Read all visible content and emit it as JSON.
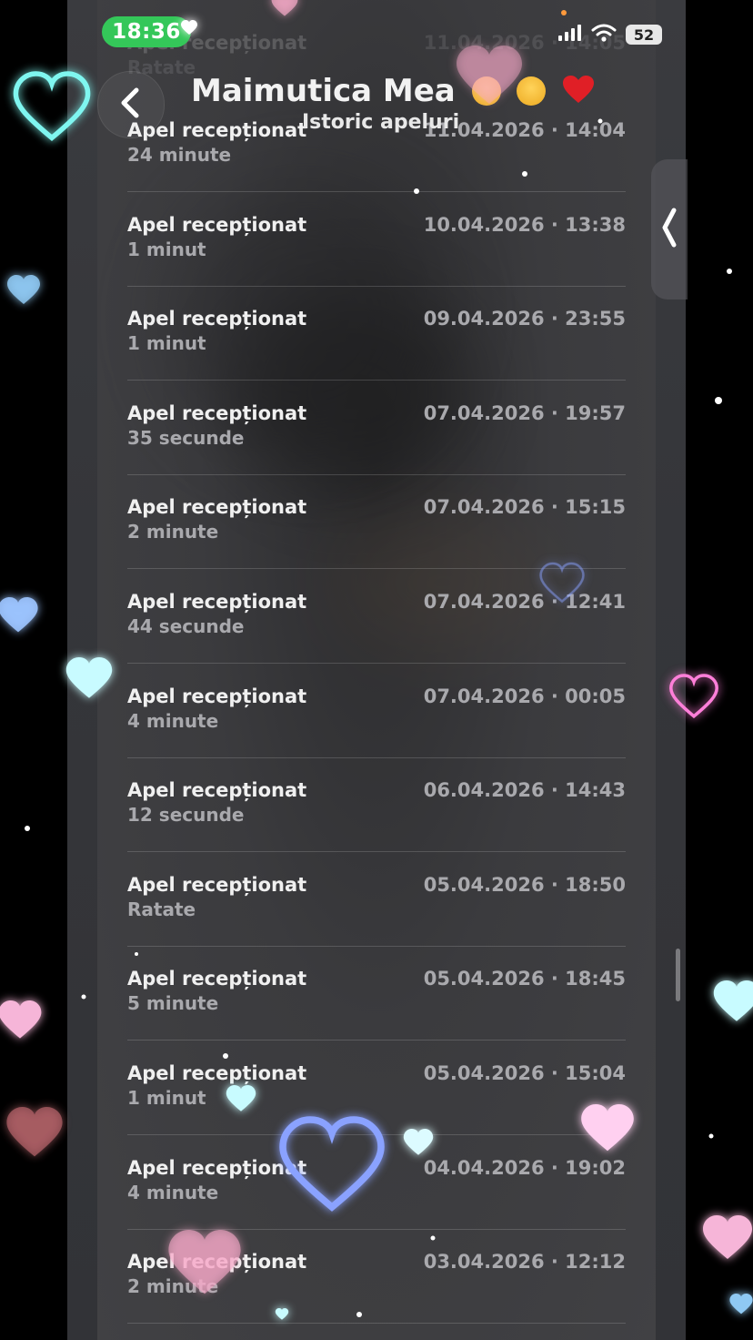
{
  "status_bar": {
    "time": "18:36",
    "battery": "52",
    "signal_icon": "cellular-signal-icon",
    "wifi_icon": "wifi-icon"
  },
  "header": {
    "title": "Maimutica Mea",
    "subtitle": "Istoric apeluri",
    "emojis": [
      "pleading-face-emoji",
      "heart-eyes-emoji",
      "red-heart-emoji"
    ],
    "back_icon": "chevron-left-icon"
  },
  "calls": {
    "partial_top": {
      "title": "Apel recepționat",
      "sub": "Ratate",
      "time": "11.04.2026 · 14:05"
    },
    "items": [
      {
        "title": "Apel recepționat",
        "sub": "24 minute",
        "time": "11.04.2026 · 14:04"
      },
      {
        "title": "Apel recepționat",
        "sub": "1 minut",
        "time": "10.04.2026 · 13:38"
      },
      {
        "title": "Apel recepționat",
        "sub": "1 minut",
        "time": "09.04.2026 · 23:55"
      },
      {
        "title": "Apel recepționat",
        "sub": "35 secunde",
        "time": "07.04.2026 · 19:57"
      },
      {
        "title": "Apel recepționat",
        "sub": "2 minute",
        "time": "07.04.2026 · 15:15"
      },
      {
        "title": "Apel recepționat",
        "sub": "44 secunde",
        "time": "07.04.2026 · 12:41"
      },
      {
        "title": "Apel recepționat",
        "sub": "4 minute",
        "time": "07.04.2026 · 00:05"
      },
      {
        "title": "Apel recepționat",
        "sub": "12 secunde",
        "time": "06.04.2026 · 14:43"
      },
      {
        "title": "Apel recepționat",
        "sub": "Ratate",
        "time": "05.04.2026 · 18:50"
      },
      {
        "title": "Apel recepționat",
        "sub": "5 minute",
        "time": "05.04.2026 · 18:45"
      },
      {
        "title": "Apel recepționat",
        "sub": "1 minut",
        "time": "05.04.2026 · 15:04"
      },
      {
        "title": "Apel recepționat",
        "sub": "4 minute",
        "time": "04.04.2026 · 19:02"
      },
      {
        "title": "Apel recepționat",
        "sub": "2 minute",
        "time": "03.04.2026 · 12:12"
      }
    ]
  },
  "side_tab": {
    "icon": "chevron-left-icon"
  },
  "colors": {
    "time_pill": "#34c759",
    "text_primary": "#f0f0f0",
    "text_secondary": "#a9a9ad",
    "panel": "#3b3b3e"
  }
}
